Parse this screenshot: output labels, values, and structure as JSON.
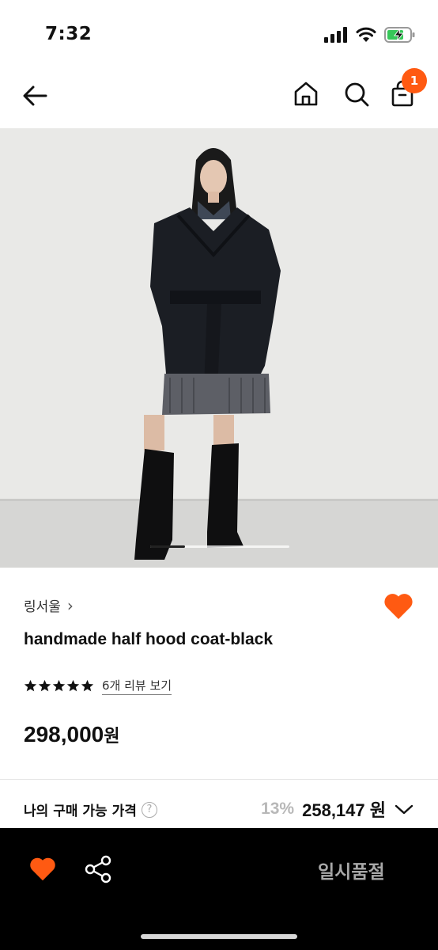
{
  "status_bar": {
    "time": "7:32",
    "icons": [
      "signal-icon",
      "wifi-icon",
      "battery-charging-icon"
    ]
  },
  "nav": {
    "icons": [
      "back-arrow-icon",
      "home-icon",
      "search-icon",
      "cart-icon"
    ],
    "cart_count": "1"
  },
  "product": {
    "image_description_icon": "product-photo",
    "brand": "링서울",
    "brand_chevron": "›",
    "name": "handmade half hood coat-black",
    "rating_stars": 5,
    "review_link": "6개 리뷰 보기",
    "price_number": "298,000",
    "price_unit": "원",
    "image_count_progress": 0.25
  },
  "my_price": {
    "label": "나의 구매 가능 가격",
    "info_icon": "?",
    "discount": "13%",
    "price": "258,147 원"
  },
  "bottom_bar": {
    "sold_out_label": "일시품절"
  },
  "colors": {
    "accent": "#ff5a12",
    "bottom_bar_bg": "#000000",
    "image_bg": "#e8e8e6"
  }
}
